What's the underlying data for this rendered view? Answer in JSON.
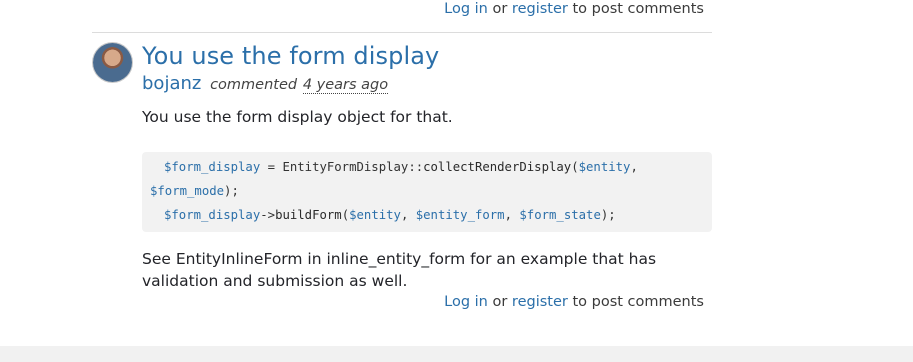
{
  "top_links": {
    "login": "Log in",
    "or": "or",
    "register": "register",
    "suffix": "to post comments"
  },
  "comment": {
    "title": "You use the form display",
    "author": "bojanz",
    "verb": "commented",
    "time": "4 years ago",
    "intro": "You use the form display object for that.",
    "code": {
      "line1": [
        {
          "t": "$form_display",
          "k": "var"
        },
        {
          "t": " = EntityFormDisplay::",
          "k": "plain"
        },
        {
          "t": "collectRenderDisplay",
          "k": "fn"
        },
        {
          "t": "(",
          "k": "plain"
        },
        {
          "t": "$entity",
          "k": "var"
        },
        {
          "t": ",",
          "k": "plain"
        }
      ],
      "line2": [
        {
          "t": "$form_mode",
          "k": "var"
        },
        {
          "t": ");",
          "k": "plain"
        }
      ],
      "line3": [
        {
          "t": "$form_display",
          "k": "var"
        },
        {
          "t": "->",
          "k": "plain"
        },
        {
          "t": "buildForm",
          "k": "fn"
        },
        {
          "t": "(",
          "k": "plain"
        },
        {
          "t": "$entity",
          "k": "var"
        },
        {
          "t": ", ",
          "k": "plain"
        },
        {
          "t": "$entity_form",
          "k": "var"
        },
        {
          "t": ", ",
          "k": "plain"
        },
        {
          "t": "$form_state",
          "k": "var"
        },
        {
          "t": ");",
          "k": "plain"
        }
      ]
    },
    "outro": "See EntityInlineForm in inline_entity_form for an example that has validation and submission as well."
  },
  "bottom_links": {
    "login": "Log in",
    "or": "or",
    "register": "register",
    "suffix": "to post comments"
  }
}
